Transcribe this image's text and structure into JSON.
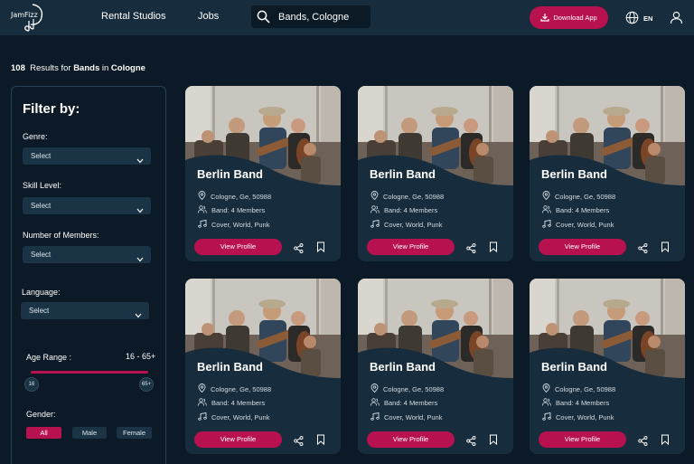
{
  "header": {
    "logo_text": "JamFizz",
    "nav": [
      "Rental Studios",
      "Jobs"
    ],
    "search_value": "Bands, Cologne",
    "download_label": "Download App",
    "language": "EN"
  },
  "results": {
    "count": "108",
    "text1": "Results for",
    "category": "Bands",
    "text2": "in",
    "location": "Cologne"
  },
  "filter": {
    "title": "Filter by:",
    "genre_label": "Genre:",
    "genre_value": "Select",
    "skill_label": "Skill Level:",
    "skill_value": "Select",
    "members_label": "Number of Members:",
    "members_value": "Select",
    "language_label": "Language:",
    "language_value": "Select",
    "age_label": "Age Range :",
    "age_value": "16 - 65+",
    "age_min": "16",
    "age_max": "65+",
    "gender_label": "Gender:",
    "gender_options": [
      "All",
      "Male",
      "Female"
    ],
    "gender_selected": "All"
  },
  "colors": {
    "accent": "#b8114f",
    "header_bg": "#172c3c",
    "page_bg": "#0b1a26",
    "card_bg": "#172c3c"
  },
  "cards": [
    {
      "name": "Berlin Band",
      "location": "Cologne, Ge, 50988",
      "members": "Band: 4 Members",
      "genres": "Cover, World, Punk",
      "button": "View Profile"
    },
    {
      "name": "Berlin Band",
      "location": "Cologne, Ge, 50988",
      "members": "Band: 4 Members",
      "genres": "Cover, World, Punk",
      "button": "View Profile"
    },
    {
      "name": "Berlin Band",
      "location": "Cologne, Ge, 50988",
      "members": "Band: 4 Members",
      "genres": "Cover, World, Punk",
      "button": "View Profile"
    },
    {
      "name": "Berlin Band",
      "location": "Cologne, Ge, 50988",
      "members": "Band: 4 Members",
      "genres": "Cover, World, Punk",
      "button": "View Profile"
    },
    {
      "name": "Berlin Band",
      "location": "Cologne, Ge, 50988",
      "members": "Band: 4 Members",
      "genres": "Cover, World, Punk",
      "button": "View Profile"
    },
    {
      "name": "Berlin Band",
      "location": "Cologne, Ge, 50988",
      "members": "Band: 4 Members",
      "genres": "Cover, World, Punk",
      "button": "View Profile"
    }
  ]
}
